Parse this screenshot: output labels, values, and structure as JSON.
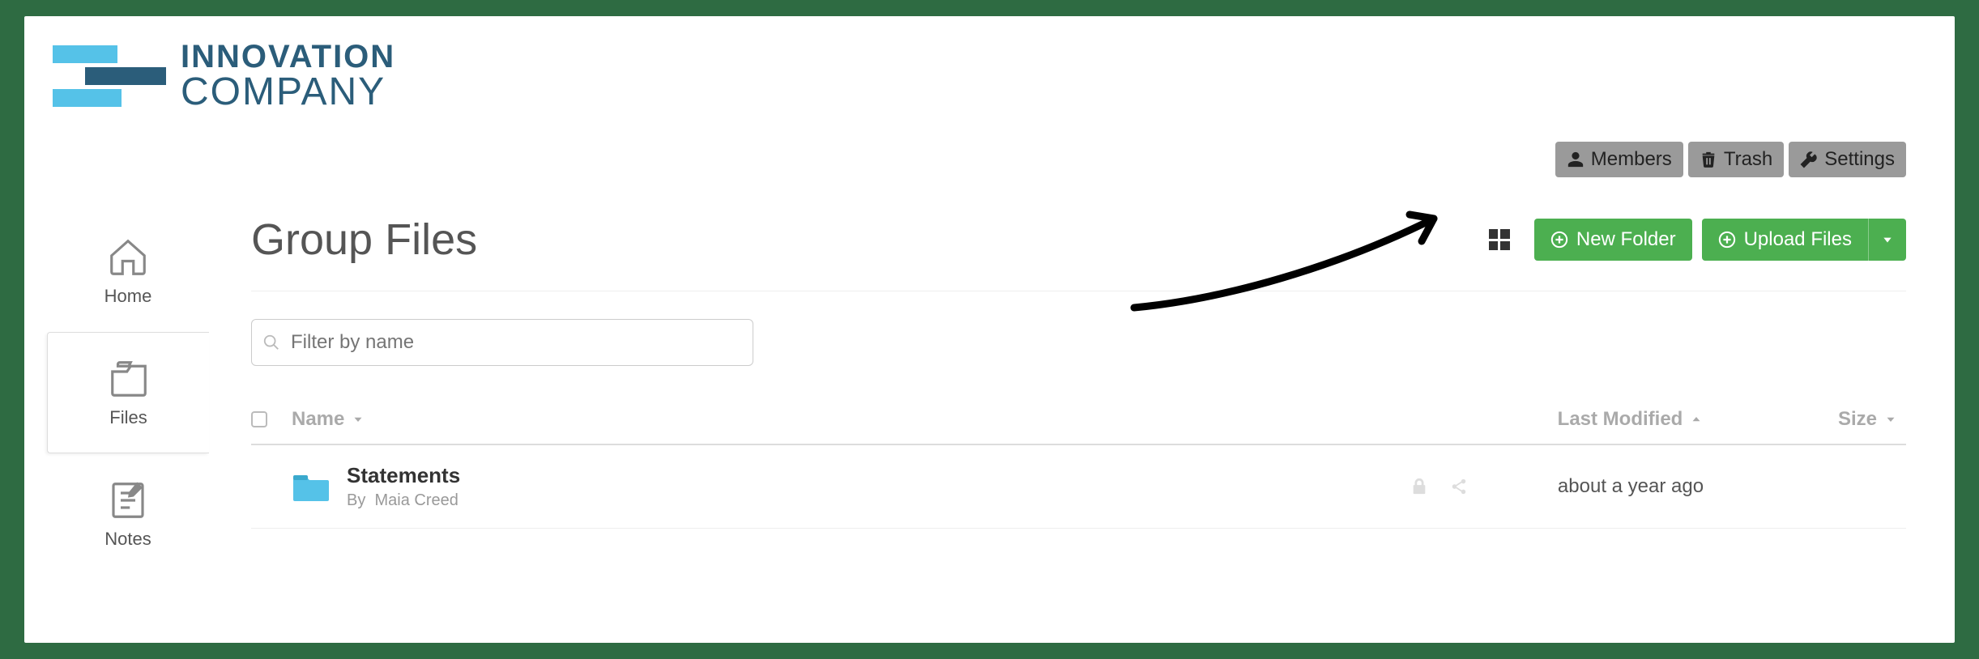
{
  "brand": {
    "line1": "INNOVATION",
    "line2": "COMPANY"
  },
  "top_buttons": {
    "members": "Members",
    "trash": "Trash",
    "settings": "Settings"
  },
  "sidebar": {
    "items": [
      {
        "label": "Home"
      },
      {
        "label": "Files"
      },
      {
        "label": "Notes"
      }
    ]
  },
  "page": {
    "title": "Group Files"
  },
  "actions": {
    "new_folder": "New Folder",
    "upload_files": "Upload Files"
  },
  "filter": {
    "placeholder": "Filter by name"
  },
  "columns": {
    "name": "Name",
    "last_modified": "Last Modified",
    "size": "Size"
  },
  "rows": [
    {
      "name": "Statements",
      "by_prefix": "By",
      "author": "Maia Creed",
      "last_modified": "about a year ago",
      "size": ""
    }
  ],
  "icons": {
    "grid_view": "grid-view",
    "plus_circle": "plus-circle",
    "caret_down": "caret-down",
    "lock": "lock",
    "share": "share",
    "user": "user",
    "trash": "trash",
    "wrench": "wrench",
    "home": "home",
    "files": "files",
    "notes": "notes",
    "search": "search",
    "chevron_down": "chevron-down",
    "chevron_up": "chevron-up",
    "folder": "folder"
  },
  "colors": {
    "accent_green": "#4caf50",
    "brand_blue": "#2b5d7a",
    "brand_light": "#55c2e8",
    "grey_btn": "#9a9a9a"
  }
}
